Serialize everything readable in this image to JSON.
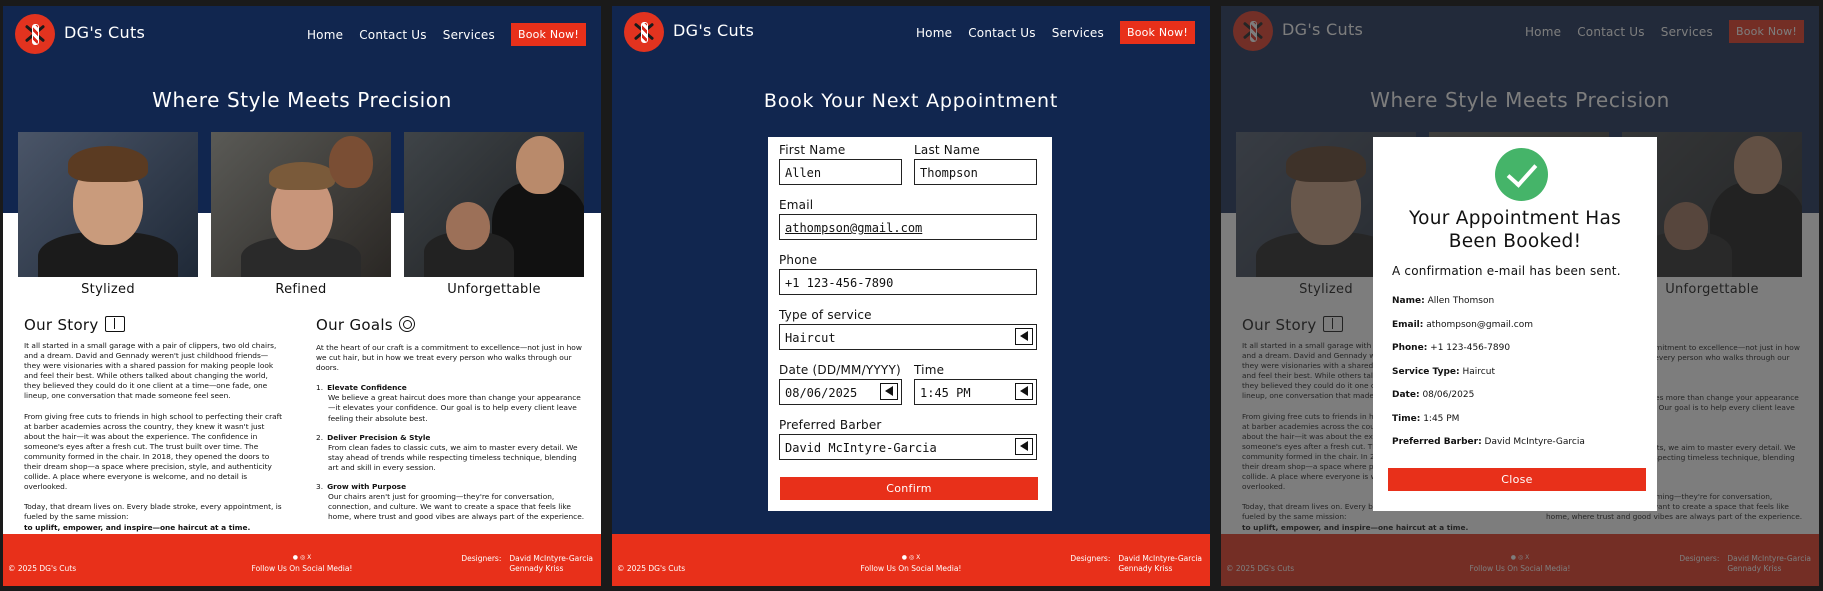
{
  "site": {
    "brand": "DG's Cuts",
    "nav": {
      "home": "Home",
      "contact": "Contact Us",
      "services": "Services",
      "book": "Book Now!"
    }
  },
  "home": {
    "hero_title": "Where Style Meets Precision",
    "captions": [
      "Stylized",
      "Refined",
      "Unforgettable"
    ],
    "story": {
      "title": "Our Story",
      "p1": "It all started in a small garage with a pair of clippers, two old chairs, and a dream.  David and Gennady weren't just childhood friends—they were visionaries with a shared passion for making people look and feel their best. While others talked about changing the world, they believed they could do it one client at a time—one fade, one lineup, one conversation that made someone feel seen.",
      "p2": "From giving free cuts to friends in high school to perfecting their craft at barber academies across the country, they knew it wasn't just about the hair—it was about the experience. The confidence in someone's eyes after a fresh cut. The trust built over time. The community formed in the chair.  In 2018, they opened the doors to their dream shop—a space where precision, style, and authenticity collide. A place where everyone is welcome, and no detail is overlooked.",
      "p3": "Today, that dream lives on. Every blade stroke, every appointment, is fueled by the same mission:",
      "p3_bold": "to uplift, empower, and inspire—one haircut at a time."
    },
    "goals": {
      "title": "Our Goals",
      "intro": "At the heart of our craft is a commitment to excellence—not just in how we cut hair, but in how we treat every person who walks through our doors.",
      "items": [
        {
          "num": "1.",
          "title": "Elevate Confidence",
          "desc": "We believe a great haircut does more than change your appearance—it elevates your confidence. Our goal is to help every client leave feeling their absolute best."
        },
        {
          "num": "2.",
          "title": "Deliver Precision & Style",
          "desc": "From clean fades to classic cuts, we aim to master every detail. We stay ahead of trends while respecting timeless technique, blending art and skill in every session."
        },
        {
          "num": "3.",
          "title": "Grow with Purpose",
          "desc": "Our chairs aren't just for grooming—they're for conversation, connection, and culture. We want to create a space that feels like home, where trust and good vibes are always part of the experience."
        }
      ]
    }
  },
  "footer": {
    "copyright": "© 2025 DG's Cuts",
    "social_icons": "● ◎ X",
    "follow": "Follow Us On Social Media!",
    "designers_label": "Designers:",
    "designer1": "David McIntyre-Garcia",
    "designer2": "Gennady Kriss"
  },
  "booking": {
    "title": "Book Your Next Appointment",
    "first_name_label": "First Name",
    "first_name": "Allen",
    "last_name_label": "Last Name",
    "last_name": "Thompson",
    "email_label": "Email",
    "email": "athompson@gmail.com",
    "phone_label": "Phone",
    "phone": "+1 123-456-7890",
    "service_label": "Type of service",
    "service": "Haircut",
    "date_label": "Date (DD/MM/YYYY)",
    "date": "08/06/2025",
    "time_label": "Time",
    "time": "1:45 PM",
    "barber_label": "Preferred Barber",
    "barber": "David McIntyre-Garcia",
    "confirm": "Confirm"
  },
  "confirmation": {
    "title_line1": "Your Appointment Has",
    "title_line2": "Been Booked!",
    "subtitle": "A confirmation e-mail has been sent.",
    "details": [
      {
        "key": "Name:",
        "value": "Allen Thomson"
      },
      {
        "key": "Email:",
        "value": "athompson@gmail.com"
      },
      {
        "key": "Phone:",
        "value": "+1 123-456-7890"
      },
      {
        "key": "Service Type:",
        "value": "Haircut"
      },
      {
        "key": "Date:",
        "value": "08/06/2025"
      },
      {
        "key": "Time:",
        "value": "1:45 PM"
      },
      {
        "key": "Preferred Barber:",
        "value": "David McIntyre-Garcia"
      }
    ],
    "close": "Close"
  }
}
